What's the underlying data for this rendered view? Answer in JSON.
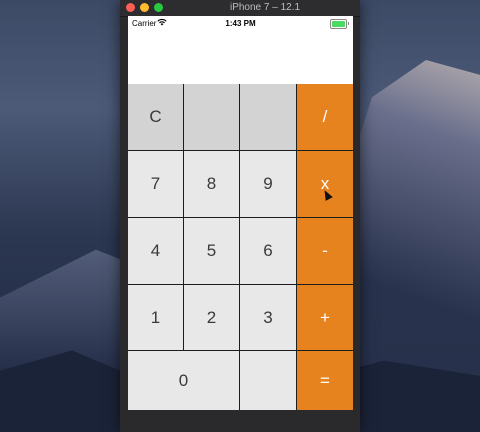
{
  "window": {
    "title": "iPhone 7 – 12.1"
  },
  "statusbar": {
    "carrier": "Carrier",
    "time": "1:43 PM"
  },
  "display": {
    "value": ""
  },
  "keys": {
    "clear": "C",
    "blank1": "",
    "blank2": "",
    "divide": "/",
    "seven": "7",
    "eight": "8",
    "nine": "9",
    "multiply": "x",
    "four": "4",
    "five": "5",
    "six": "6",
    "minus": "-",
    "one": "1",
    "two": "2",
    "three": "3",
    "plus": "+",
    "zero": "0",
    "blank3": "",
    "equals": "="
  },
  "colors": {
    "operator": "#e7831f",
    "top_row": "#d3d3d3",
    "number": "#e8e8e8"
  }
}
